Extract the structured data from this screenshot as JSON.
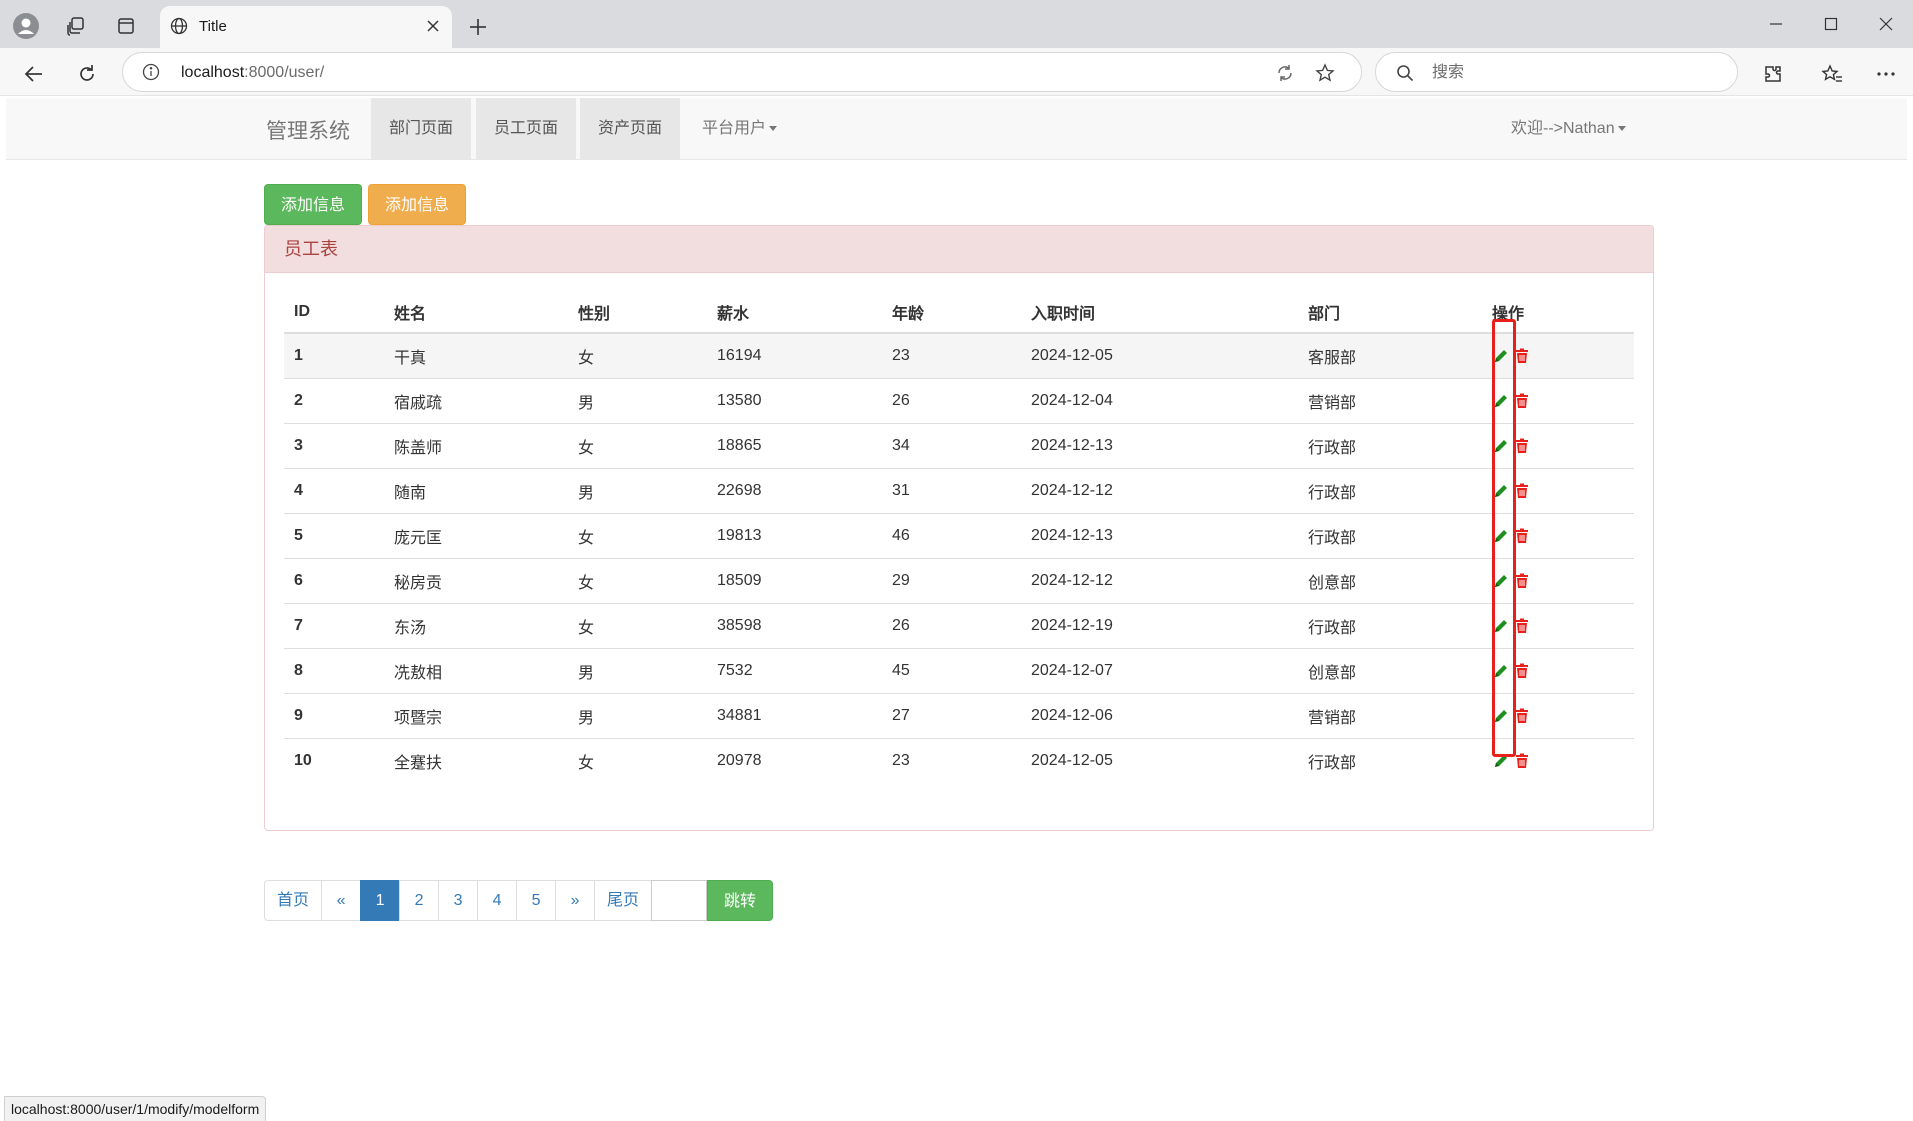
{
  "browser": {
    "tab_title": "Title",
    "address": {
      "host": "localhost",
      "path": ":8000/user/"
    },
    "search_placeholder": "搜索",
    "status_url": "localhost:8000/user/1/modify/modelform"
  },
  "navbar": {
    "brand": "管理系统",
    "items": [
      {
        "label": "部门页面"
      },
      {
        "label": "员工页面"
      },
      {
        "label": "资产页面"
      }
    ],
    "dropdown_label": "平台用户",
    "user_label": "欢迎-->Nathan"
  },
  "actions": {
    "add_green": "添加信息",
    "add_orange": "添加信息"
  },
  "panel": {
    "title": "员工表",
    "columns": [
      "ID",
      "姓名",
      "性别",
      "薪水",
      "年龄",
      "入职时间",
      "部门",
      "操作"
    ],
    "rows": [
      {
        "id": "1",
        "name": "干真",
        "gender": "女",
        "salary": "16194",
        "age": "23",
        "date": "2024-12-05",
        "dept": "客服部"
      },
      {
        "id": "2",
        "name": "宿戚疏",
        "gender": "男",
        "salary": "13580",
        "age": "26",
        "date": "2024-12-04",
        "dept": "营销部"
      },
      {
        "id": "3",
        "name": "陈盖师",
        "gender": "女",
        "salary": "18865",
        "age": "34",
        "date": "2024-12-13",
        "dept": "行政部"
      },
      {
        "id": "4",
        "name": "随南",
        "gender": "男",
        "salary": "22698",
        "age": "31",
        "date": "2024-12-12",
        "dept": "行政部"
      },
      {
        "id": "5",
        "name": "庞元匡",
        "gender": "女",
        "salary": "19813",
        "age": "46",
        "date": "2024-12-13",
        "dept": "行政部"
      },
      {
        "id": "6",
        "name": "秘房贡",
        "gender": "女",
        "salary": "18509",
        "age": "29",
        "date": "2024-12-12",
        "dept": "创意部"
      },
      {
        "id": "7",
        "name": "东汤",
        "gender": "女",
        "salary": "38598",
        "age": "26",
        "date": "2024-12-19",
        "dept": "行政部"
      },
      {
        "id": "8",
        "name": "冼敖相",
        "gender": "男",
        "salary": "7532",
        "age": "45",
        "date": "2024-12-07",
        "dept": "创意部"
      },
      {
        "id": "9",
        "name": "项暨宗",
        "gender": "男",
        "salary": "34881",
        "age": "27",
        "date": "2024-12-06",
        "dept": "营销部"
      },
      {
        "id": "10",
        "name": "全蹇扶",
        "gender": "女",
        "salary": "20978",
        "age": "23",
        "date": "2024-12-05",
        "dept": "行政部"
      }
    ]
  },
  "pagination": {
    "first": "首页",
    "prev": "«",
    "pages": [
      "1",
      "2",
      "3",
      "4",
      "5"
    ],
    "active_page": "1",
    "next": "»",
    "last": "尾页",
    "jump_value": "",
    "jump_button": "跳转"
  },
  "colors": {
    "edit_icon": "#1e8e1e",
    "delete_icon": "#e8201c",
    "highlight": "#e8201c",
    "primary": "#337ab7",
    "success": "#5cb85c",
    "warning": "#f0ad4e"
  },
  "icons": {
    "edit": "pencil-icon",
    "delete": "trash-icon"
  }
}
